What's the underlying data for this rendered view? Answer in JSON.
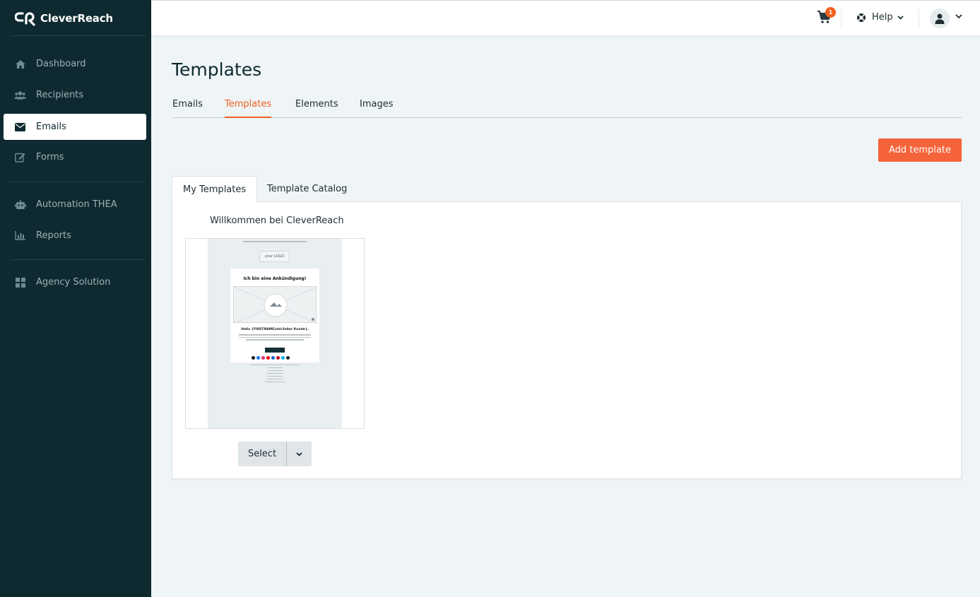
{
  "brand": {
    "name": "CleverReach"
  },
  "sidebar": {
    "items": [
      {
        "label": "Dashboard",
        "icon": "home-icon"
      },
      {
        "label": "Recipients",
        "icon": "users-icon"
      },
      {
        "label": "Emails",
        "icon": "envelope-icon",
        "active": true
      },
      {
        "label": "Forms",
        "icon": "edit-icon"
      },
      {
        "label": "Automation THEA",
        "icon": "robot-icon"
      },
      {
        "label": "Reports",
        "icon": "chart-icon"
      },
      {
        "label": "Agency Solution",
        "icon": "grid-icon"
      }
    ]
  },
  "topbar": {
    "cart_count": "1",
    "help_label": "Help"
  },
  "page": {
    "title": "Templates",
    "tabs": [
      {
        "label": "Emails"
      },
      {
        "label": "Templates",
        "active": true
      },
      {
        "label": "Elements"
      },
      {
        "label": "Images"
      }
    ],
    "add_button": "Add template",
    "subtabs": [
      {
        "label": "My Templates",
        "active": true
      },
      {
        "label": "Template Catalog"
      }
    ]
  },
  "template_card": {
    "title": "Willkommen bei CleverReach",
    "preview": {
      "logo": "your LOGO",
      "heading": "Ich bin eine Ankündigung!",
      "greeting": "Hallo {FIRSTNAME|old:lieber Kunde},"
    },
    "select_label": "Select"
  },
  "colors": {
    "sidebar_bg": "#0e2a30",
    "accent": "#f1601f",
    "button_accent": "#f5633a"
  }
}
